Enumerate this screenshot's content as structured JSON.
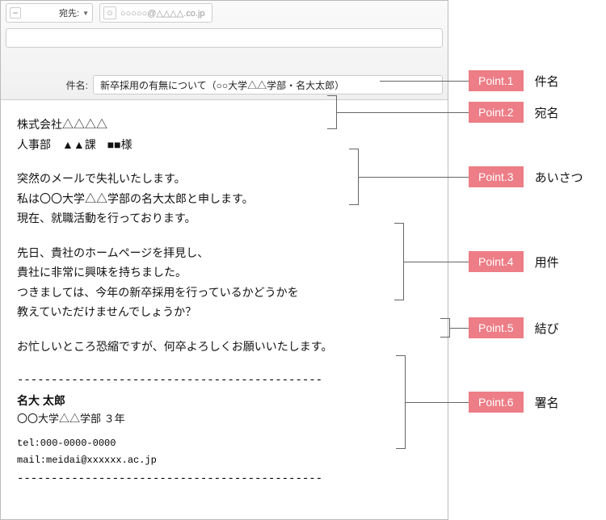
{
  "header": {
    "to_button_label": "宛先:",
    "recipient": "○○○○○@△△△△.co.jp",
    "subject_label": "件名:",
    "subject_value": "新卒採用の有無について（○○大学△△学部・名大太郎）"
  },
  "body": {
    "addressee": {
      "line1": "株式会社△△△△",
      "line2": "人事部　▲▲課　■■様"
    },
    "greeting": {
      "line1": "突然のメールで失礼いたします。",
      "line2": "私は〇〇大学△△学部の名大太郎と申します。",
      "line3": "現在、就職活動を行っております。"
    },
    "main": {
      "line1": "先日、貴社のホームページを拝見し、",
      "line2": "貴社に非常に興味を持ちました。",
      "line3": "つきましては、今年の新卒採用を行っているかどうかを",
      "line4": "教えていただけませんでしょうか？"
    },
    "closing": {
      "line1": "お忙しいところ恐縮ですが、何卒よろしくお願いいたします。"
    },
    "signature": {
      "sep": "---------------------------------------------",
      "name": "名大 太郎",
      "affil": "〇〇大学△△学部 ３年",
      "tel": "tel:000-0000-0000",
      "mail": "mail:meidai@xxxxxx.ac.jp"
    }
  },
  "points": {
    "p1": {
      "badge": "Point.1",
      "label": "件名"
    },
    "p2": {
      "badge": "Point.2",
      "label": "宛名"
    },
    "p3": {
      "badge": "Point.3",
      "label": "あいさつ"
    },
    "p4": {
      "badge": "Point.4",
      "label": "用件"
    },
    "p5": {
      "badge": "Point.5",
      "label": "結び"
    },
    "p6": {
      "badge": "Point.6",
      "label": "署名"
    }
  }
}
